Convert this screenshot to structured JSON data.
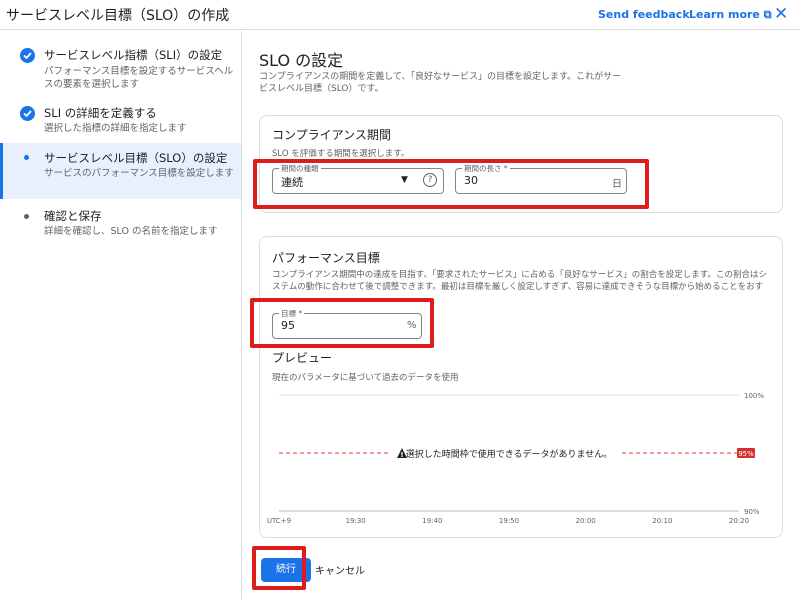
{
  "header": {
    "title": "サービスレベル目標（SLO）の作成",
    "send_feedback": "Send feedback",
    "learn_more": "Learn more ⧉",
    "close_icon": "close-icon"
  },
  "sidebar": {
    "steps": [
      {
        "title": "サービスレベル指標（SLI）の設定",
        "subtitle": "パフォーマンス目標を設定するサービスヘルスの要素を選択します",
        "state": "done"
      },
      {
        "title": "SLI の詳細を定義する",
        "subtitle": "選択した指標の詳細を指定します",
        "state": "done"
      },
      {
        "title": "サービスレベル目標（SLO）の設定",
        "subtitle": "サービスのパフォーマンス目標を設定します",
        "state": "active"
      },
      {
        "title": "確認と保存",
        "subtitle": "詳細を確認し、SLO の名前を指定します",
        "state": "pending"
      }
    ]
  },
  "main": {
    "title": "SLO の設定",
    "description": "コンプライアンスの期間を定義して、「良好なサービス」の目標を設定します。これがサービスレベル目標（SLO）です。",
    "compliance": {
      "title": "コンプライアンス期間",
      "description": "SLO を評価する期間を選択します。",
      "period_type_label": "期間の種類",
      "period_type_value": "連続",
      "period_length_label": "期間の長さ *",
      "period_length_value": "30",
      "period_length_unit": "日"
    },
    "performance": {
      "title": "パフォーマンス目標",
      "description": "コンプライアンス期間中の達成を目指す、「要求されたサービス」に占める「良好なサービス」の割合を設定します。この割合はシステムの動作に合わせて後で調整できます。最初は目標を厳しく設定しすぎず、容易に達成できそうな目標から始めることをおすすめします。",
      "goal_label": "目標 *",
      "goal_value": "95",
      "goal_unit": "%"
    },
    "preview": {
      "title": "プレビュー",
      "description": "現在のパラメータに基づいて過去のデータを使用",
      "no_data": "選択した時間枠で使用できるデータがありません。"
    },
    "buttons": {
      "continue": "続行",
      "cancel": "キャンセル"
    }
  },
  "chart_data": {
    "type": "line",
    "x": [
      "UTC+9",
      "19:30",
      "19:40",
      "19:50",
      "20:00",
      "20:10",
      "20:20"
    ],
    "ylim": [
      90,
      100
    ],
    "y_tick_labels": [
      "100%",
      "90%"
    ],
    "threshold": {
      "value": 95,
      "label": "95%",
      "color": "#e53935"
    },
    "series": [],
    "grid": true
  },
  "colors": {
    "accent": "#1a73e8",
    "highlight": "#e01b1b",
    "threshold": "#e53935"
  }
}
